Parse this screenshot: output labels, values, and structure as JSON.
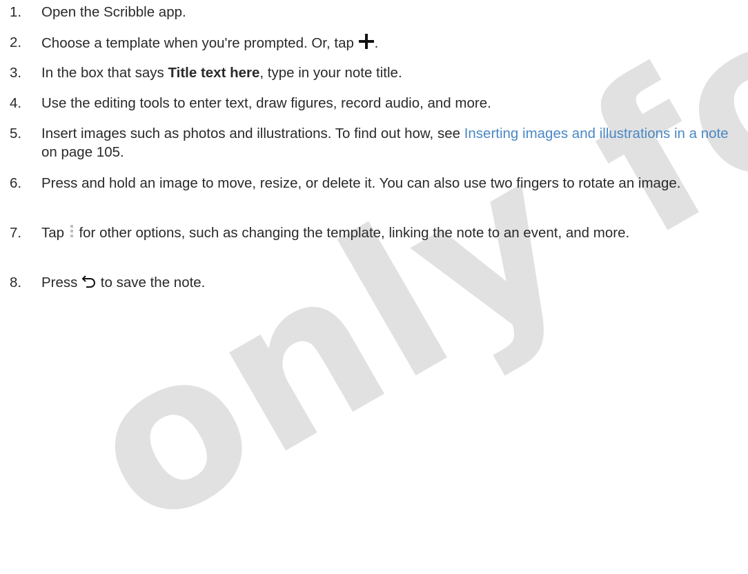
{
  "steps": [
    {
      "number": "1.",
      "text": "Open the Scribble app."
    },
    {
      "number": "2.",
      "text_before": "Choose a template when you're prompted. Or, tap ",
      "text_after": ".",
      "icon": "plus-icon"
    },
    {
      "number": "3.",
      "text_before": "In the box that says ",
      "bold": "Title text here",
      "text_after": ", type in your note title."
    },
    {
      "number": "4.",
      "text": "Use the editing tools to enter text, draw figures, record audio, and more."
    },
    {
      "number": "5.",
      "text_before": "Insert images such as photos and illustrations. To find out how, see ",
      "link": "Inserting images and illustrations in a note",
      "text_after": " on page 105."
    },
    {
      "number": "6.",
      "text": "Press and hold an image to move, resize, or delete it. You can also use two fingers to rotate an image."
    },
    {
      "number": "7.",
      "text_before": "Tap ",
      "text_after": " for other options, such as changing the template, linking the note to an event, and more.",
      "icon": "overflow-menu-icon"
    },
    {
      "number": "8.",
      "text_before": "Press ",
      "text_after": " to save the note.",
      "icon": "back-icon"
    }
  ],
  "watermark": "only for certific",
  "colors": {
    "text": "#2a2a2a",
    "link": "#4a88c4",
    "watermark": "#c9c9c9"
  }
}
